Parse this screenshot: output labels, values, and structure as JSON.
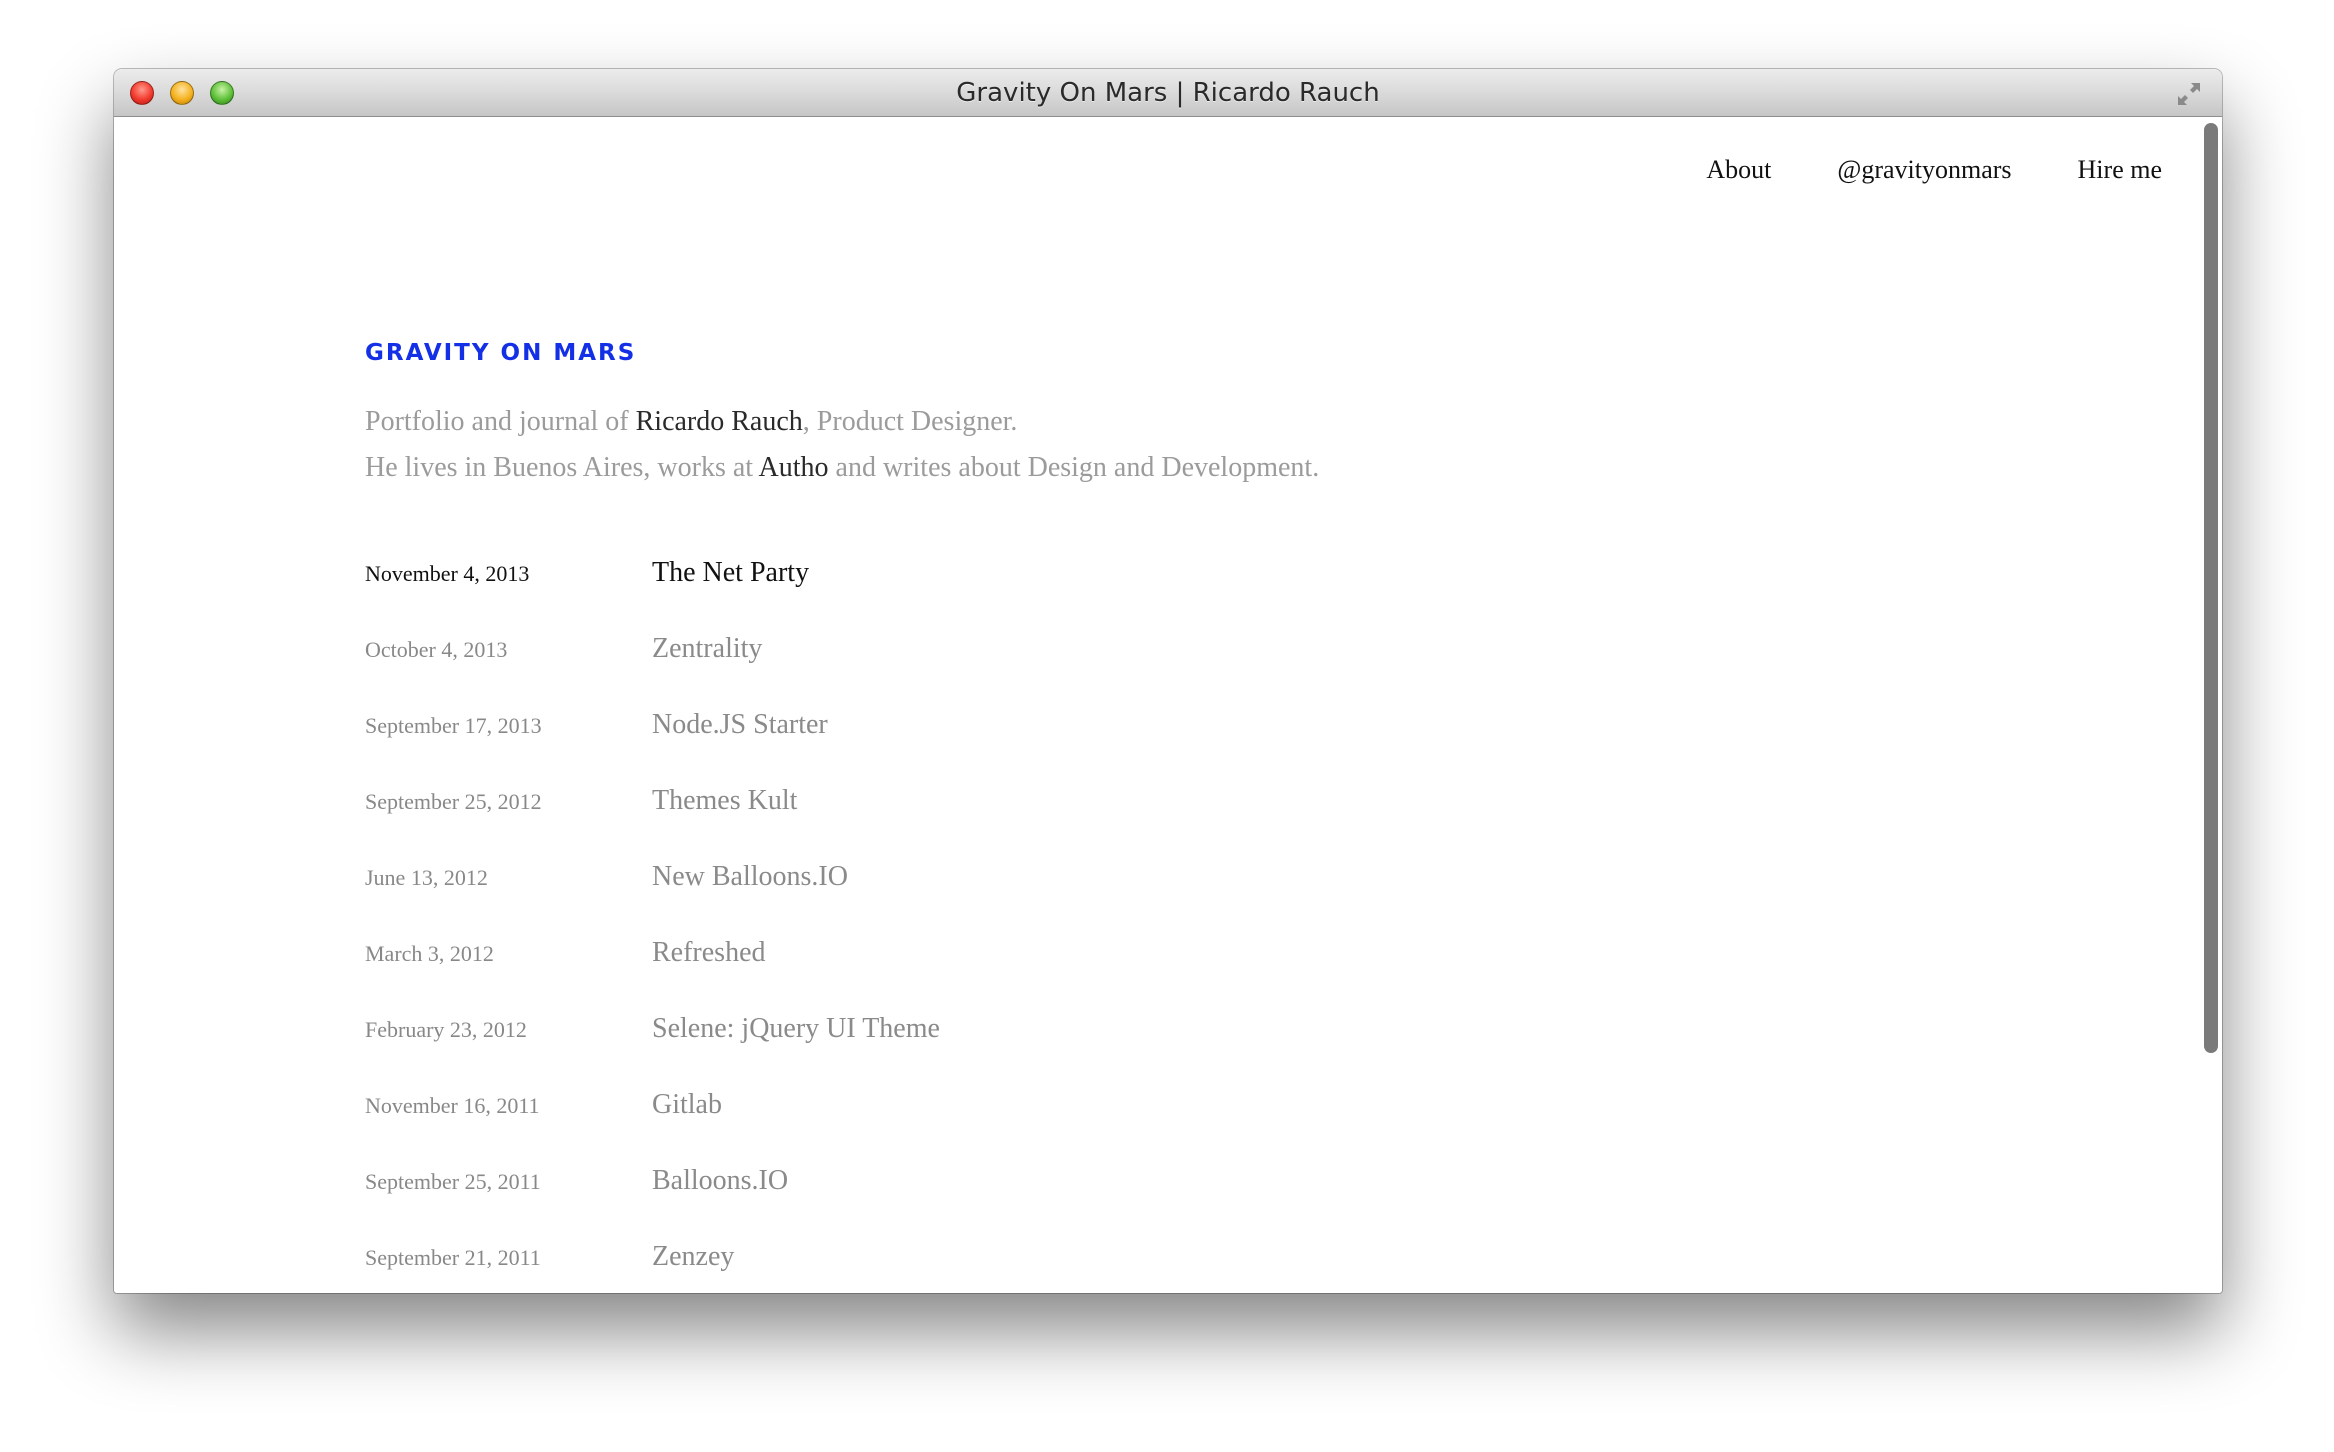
{
  "window": {
    "title": "Gravity On Mars | Ricardo Rauch",
    "controls": {
      "close": "close-button",
      "minimize": "minimize-button",
      "zoom": "zoom-button",
      "fullscreen_icon": "fullscreen-arrows-icon"
    }
  },
  "nav": {
    "items": [
      {
        "label": "About"
      },
      {
        "label": "@gravityonmars"
      },
      {
        "label": "Hire me"
      }
    ]
  },
  "site": {
    "title": "GRAVITY ON MARS",
    "intro": {
      "line1_prefix": "Portfolio and journal of ",
      "line1_link": "Ricardo Rauch",
      "line1_suffix": ", Product Designer.",
      "line2_prefix": "He lives in Buenos Aires, works at ",
      "line2_link": "Autho",
      "line2_suffix": " and writes about Design and Development."
    }
  },
  "posts": [
    {
      "date": "November 4, 2013",
      "title": "The Net Party"
    },
    {
      "date": "October 4, 2013",
      "title": "Zentrality"
    },
    {
      "date": "September 17, 2013",
      "title": "Node.JS Starter"
    },
    {
      "date": "September 25, 2012",
      "title": "Themes Kult"
    },
    {
      "date": "June 13, 2012",
      "title": "New Balloons.IO"
    },
    {
      "date": "March 3, 2012",
      "title": "Refreshed"
    },
    {
      "date": "February 23, 2012",
      "title": "Selene: jQuery UI Theme"
    },
    {
      "date": "November 16, 2011",
      "title": "Gitlab"
    },
    {
      "date": "September 25, 2011",
      "title": "Balloons.IO"
    },
    {
      "date": "September 21, 2011",
      "title": "Zenzey"
    }
  ],
  "colors": {
    "accent": "#1330e6",
    "muted_text": "#9b9b9b",
    "strong_text": "#111111"
  }
}
